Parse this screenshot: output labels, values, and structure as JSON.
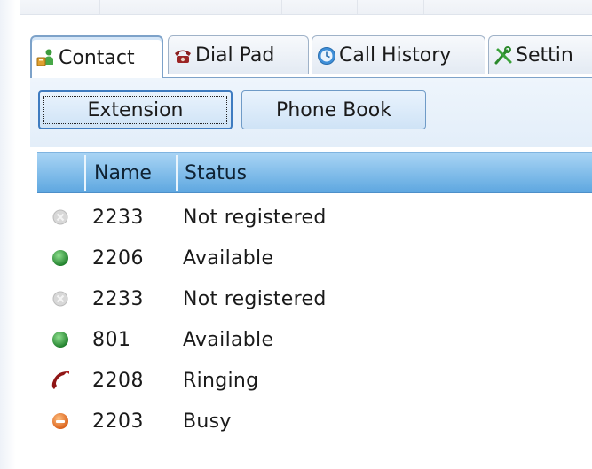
{
  "tabs": [
    {
      "label": "Contact",
      "icon": "contact-person-icon",
      "active": true
    },
    {
      "label": "Dial Pad",
      "icon": "telephone-icon",
      "active": false
    },
    {
      "label": "Call History",
      "icon": "clock-icon",
      "active": false
    },
    {
      "label": "Settin",
      "icon": "tools-icon",
      "active": false
    }
  ],
  "buttons": {
    "extension": "Extension",
    "phone_book": "Phone Book"
  },
  "columns": {
    "name": "Name",
    "status": "Status"
  },
  "contacts": [
    {
      "name": "2233",
      "status": "Not registered",
      "icon": "not-registered-icon"
    },
    {
      "name": "2206",
      "status": "Available",
      "icon": "available-icon"
    },
    {
      "name": "2233",
      "status": "Not registered",
      "icon": "not-registered-icon"
    },
    {
      "name": "801",
      "status": "Available",
      "icon": "available-icon"
    },
    {
      "name": "2208",
      "status": "Ringing",
      "icon": "ringing-handset-icon"
    },
    {
      "name": "2203",
      "status": "Busy",
      "icon": "busy-icon"
    }
  ],
  "colors": {
    "header_light": "#a8d4f4",
    "header_dark": "#5ea7e0",
    "available": "#2e9a3a",
    "ringing": "#9b1b1b",
    "busy": "#e8782a"
  }
}
